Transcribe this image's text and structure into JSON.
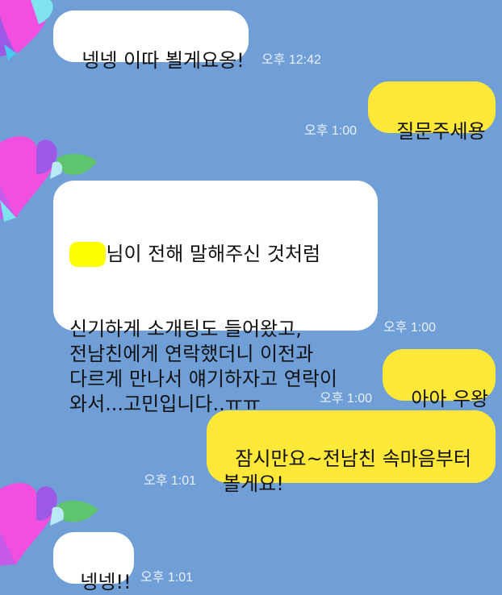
{
  "messages": [
    {
      "id": "m1",
      "side": "received",
      "text": "넹넹 이따 뵐게요옹!",
      "time": "오후 12:42"
    },
    {
      "id": "m2",
      "side": "sent",
      "text": "질문주세용",
      "time": "오후 1:00"
    },
    {
      "id": "m3",
      "side": "received",
      "masked_name": "■■",
      "text_first_line": "님이 전해 말해주신 것처럼",
      "text_rest": "신기하게 소개팅도 들어왔고,\n전남친에게 연락했더니 이전과\n다르게 만나서 얘기하자고 연락이\n와서...고민입니다..ㅠㅠ",
      "time": "오후 1:00"
    },
    {
      "id": "m4",
      "side": "sent",
      "text": "아아 우왕",
      "time": "오후 1:00"
    },
    {
      "id": "m5",
      "side": "sent",
      "text": "잠시만요~전남친 속마음부터\n볼게요!",
      "time": "오후 1:01"
    },
    {
      "id": "m6",
      "side": "received",
      "text": "넹넹!!",
      "time": "오후 1:01"
    }
  ],
  "colors": {
    "background": "#6f9fd6",
    "sent_bubble": "#ffe838",
    "received_bubble": "#ffffff",
    "name_mask": "#ffff00"
  },
  "icons": {
    "avatar": "heart-avatar-icon"
  }
}
